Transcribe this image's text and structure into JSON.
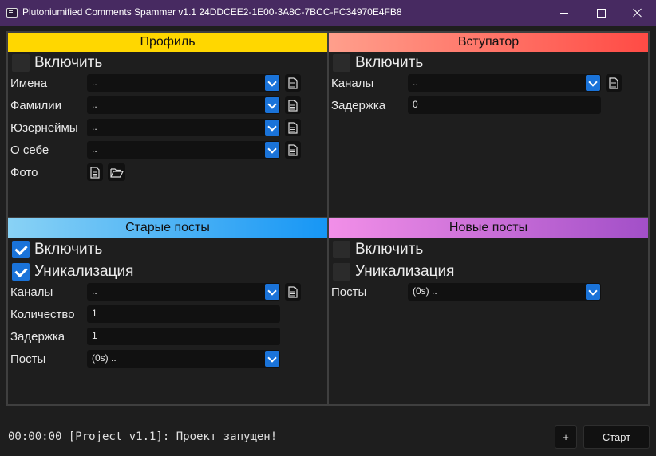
{
  "window": {
    "title": "Plutoniumified Comments Spammer v1.1 24DDCEE2-1E00-3A8C-7BCC-FC34970E4FB8",
    "icon": "app-terminal-icon"
  },
  "colors": {
    "profile_header": "#ffd700",
    "joiner_header_from": "#ff9f8c",
    "joiner_header_to": "#ff4b45",
    "old_posts_header_from": "#89d2f5",
    "old_posts_header_to": "#1696f5",
    "new_posts_header_from": "#f28fe8",
    "new_posts_header_to": "#a24fc8",
    "accent": "#1a73d9",
    "titlebar": "#472a61"
  },
  "profile": {
    "title": "Профиль",
    "enable_label": "Включить",
    "enable_checked": false,
    "names_label": "Имена",
    "names_value": "..",
    "surnames_label": "Фамилии",
    "surnames_value": "..",
    "usernames_label": "Юзернеймы",
    "usernames_value": "..",
    "about_label": "О себе",
    "about_value": "..",
    "photo_label": "Фото"
  },
  "joiner": {
    "title": "Вступатор",
    "enable_label": "Включить",
    "enable_checked": false,
    "channels_label": "Каналы",
    "channels_value": "..",
    "delay_label": "Задержка",
    "delay_value": "0"
  },
  "old_posts": {
    "title": "Старые посты",
    "enable_label": "Включить",
    "enable_checked": true,
    "unique_label": "Уникализация",
    "unique_checked": true,
    "channels_label": "Каналы",
    "channels_value": "..",
    "count_label": "Количество",
    "count_value": "1",
    "delay_label": "Задержка",
    "delay_value": "1",
    "posts_label": "Посты",
    "posts_value": "(0s) .."
  },
  "new_posts": {
    "title": "Новые посты",
    "enable_label": "Включить",
    "enable_checked": false,
    "unique_label": "Уникализация",
    "unique_checked": false,
    "posts_label": "Посты",
    "posts_value": "(0s) .."
  },
  "footer": {
    "log": "00:00:00 [Project v1.1]: Проект запущен!",
    "add_label": "+",
    "start_label": "Старт"
  }
}
